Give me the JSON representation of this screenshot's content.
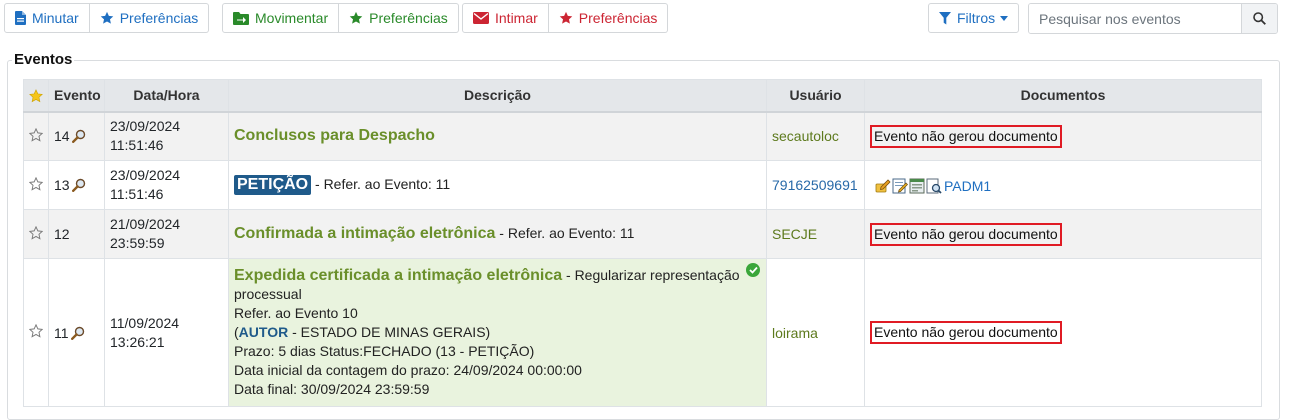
{
  "toolbar": {
    "group1": {
      "primary": "Minutar",
      "prefs": "Preferências"
    },
    "group2": {
      "primary": "Movimentar",
      "prefs": "Preferências"
    },
    "group3": {
      "primary": "Intimar",
      "prefs": "Preferências"
    },
    "filter_label": "Filtros",
    "search_placeholder": "Pesquisar nos eventos"
  },
  "legend": "Eventos",
  "table": {
    "headers": {
      "evento": "Evento",
      "datahora": "Data/Hora",
      "descricao": "Descrição",
      "usuario": "Usuário",
      "documentos": "Documentos"
    },
    "rows": [
      {
        "evento": "14",
        "date": "23/09/2024",
        "time": "11:51:46",
        "title": "Conclusos para Despacho",
        "suffix": "",
        "usuario": "secautoloc",
        "doc": "Evento não gerou documento"
      },
      {
        "evento": "13",
        "date": "23/09/2024",
        "time": "11:51:46",
        "title": "PETIÇÃO",
        "suffix": " - Refer. ao Evento: 11",
        "usuario": "79162509691",
        "doc": "PADM1"
      },
      {
        "evento": "12",
        "date": "21/09/2024",
        "time": "23:59:59",
        "title": "Confirmada a intimação eletrônica",
        "suffix": " - Refer. ao Evento: 11",
        "usuario": "SECJE",
        "doc": "Evento não gerou documento"
      },
      {
        "evento": "11",
        "date": "11/09/2024",
        "time": "13:26:21",
        "title": "Expedida certificada a intimação eletrônica",
        "suffix": " - Regularizar representação processual",
        "line_refer": "Refer. ao Evento 10",
        "autor_open": "(",
        "autor": "AUTOR",
        "autor_rest": " - ESTADO DE MINAS GERAIS)",
        "line_prazo": "Prazo: 5 dias Status:FECHADO (13 - PETIÇÃO)",
        "line_inicial": "Data inicial da contagem do prazo: 24/09/2024 00:00:00",
        "line_final": "Data final: 30/09/2024 23:59:59",
        "usuario": "loirama",
        "doc": "Evento não gerou documento"
      }
    ]
  },
  "colors": {
    "accent_blue": "#1f6fc1",
    "green": "#2a8a2a",
    "red": "#cc2533",
    "event_title": "#6a8f2a",
    "highlight_box": "#e01b24"
  }
}
